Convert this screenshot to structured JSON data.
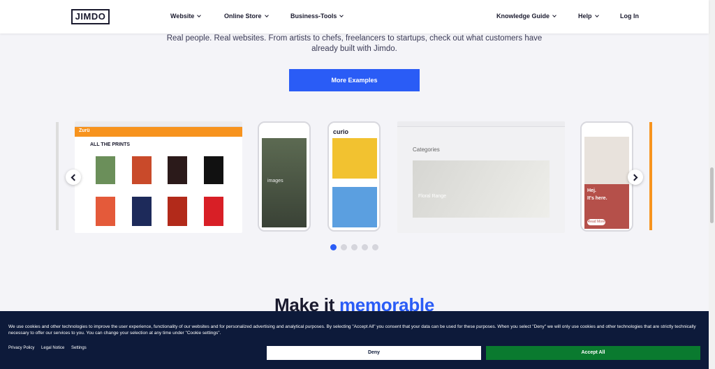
{
  "header": {
    "logo": "JIMDO",
    "nav": {
      "website": "Website",
      "online_store": "Online Store",
      "business_tools": "Business-Tools",
      "knowledge_guide": "Knowledge Guide",
      "help": "Help",
      "login": "Log In"
    }
  },
  "intro": {
    "text": "Real people. Real websites. From artists to chefs, freelancers to startups, check out what customers have already built with Jimdo."
  },
  "cta": {
    "label": "More Examples"
  },
  "carousel": {
    "slides": [
      {
        "type": "browser",
        "heading": "ALL THE PRINTS",
        "brand": "Zurü"
      },
      {
        "type": "phone",
        "caption": "images"
      },
      {
        "type": "phone",
        "brand": "curio"
      },
      {
        "type": "browser",
        "heading": "Categories",
        "feature": "Floral Range"
      },
      {
        "type": "phone",
        "line1": "Hej.",
        "line2": "It's here.",
        "button": "Read More"
      }
    ],
    "active_dot": 0,
    "dot_count": 5
  },
  "section": {
    "heading_plain": "Make it ",
    "heading_accent": "memorable"
  },
  "cookie_banner": {
    "text": "We use cookies and other technologies to improve the user experience, functionality of our websites and for personalized advertising and analytical purposes. By selecting \"Accept All\" you consent that your data can be used for these purposes. When you select \"Deny\" we will only use cookies and other technologies that are strictly technically necessary to offer our services to you. You can change your selection at any time under \"Cookie settings\".",
    "links": {
      "privacy": "Privacy Policy",
      "legal": "Legal Notice",
      "settings": "Settings"
    },
    "deny_label": "Deny",
    "accept_label": "Accept All"
  },
  "colors": {
    "accent": "#2a5cf6",
    "banner_bg": "#0d1a3a",
    "accept": "#0a7a2f"
  }
}
